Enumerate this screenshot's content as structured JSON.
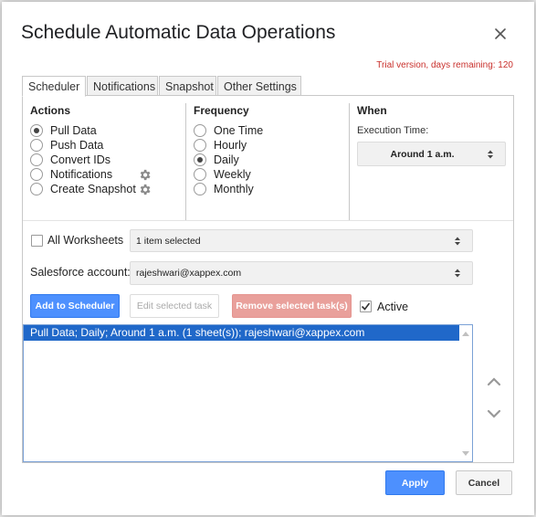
{
  "dialog": {
    "title": "Schedule Automatic Data Operations",
    "trial_notice": "Trial version, days remaining: 120"
  },
  "tabs": [
    {
      "label": "Scheduler",
      "active": true
    },
    {
      "label": "Notifications",
      "active": false
    },
    {
      "label": "Snapshot",
      "active": false
    },
    {
      "label": "Other Settings",
      "active": false
    }
  ],
  "actions": {
    "heading": "Actions",
    "options": [
      "Pull Data",
      "Push Data",
      "Convert IDs",
      "Notifications",
      "Create Snapshot"
    ],
    "selected": "Pull Data"
  },
  "frequency": {
    "heading": "Frequency",
    "options": [
      "One Time",
      "Hourly",
      "Daily",
      "Weekly",
      "Monthly"
    ],
    "selected": "Daily"
  },
  "when": {
    "heading": "When",
    "execution_label": "Execution Time:",
    "execution_value": "Around 1 a.m."
  },
  "worksheets": {
    "label": "All Worksheets",
    "checked": false,
    "select_value": "1 item selected"
  },
  "salesforce": {
    "label": "Salesforce account:",
    "value": "rajeshwari@xappex.com"
  },
  "buttons": {
    "add": "Add to Scheduler",
    "edit": "Edit selected task",
    "remove": "Remove selected task(s)",
    "apply": "Apply",
    "cancel": "Cancel"
  },
  "active_toggle": {
    "label": "Active",
    "checked": true
  },
  "tasks": [
    "Pull Data; Daily; Around 1 a.m. (1 sheet(s)); rajeshwari@xappex.com"
  ],
  "colors": {
    "primary": "#4d90fe",
    "danger": "#e9a09b",
    "selection": "#2068c9",
    "trial_text": "#c9302c"
  }
}
